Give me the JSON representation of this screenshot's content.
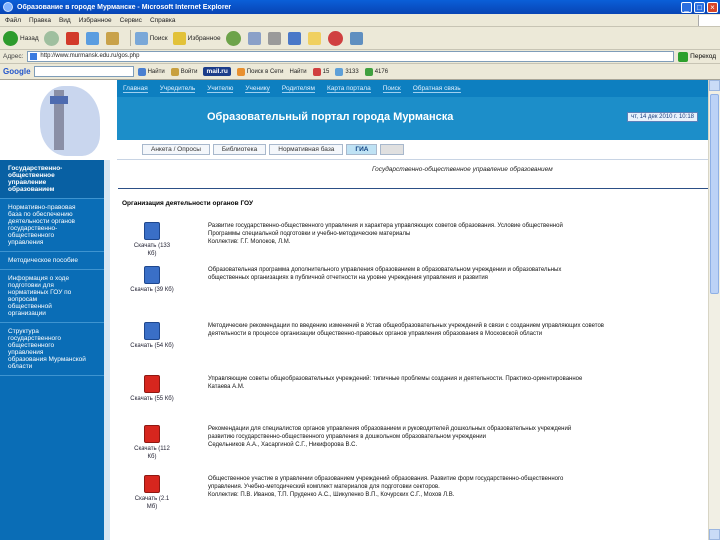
{
  "window": {
    "title": "Образование в городе Мурманске - Microsoft Internet Explorer"
  },
  "menu": [
    "Файл",
    "Правка",
    "Вид",
    "Избранное",
    "Сервис",
    "Справка"
  ],
  "toolbar": {
    "back": "Назад",
    "search": "Поиск",
    "favorites": "Избранное"
  },
  "address": {
    "label": "Адрес:",
    "url": "http://www.murmansk.edu.ru/gos.php",
    "go": "Переход"
  },
  "google_bar": {
    "label": "Google",
    "items": [
      "Найти",
      "Войти"
    ],
    "mailru": "mail.ru",
    "search_placeholder": "Поиск в Сети",
    "right": [
      "Найти",
      "15",
      "3133",
      "4176"
    ]
  },
  "site": {
    "nav": [
      "Главная",
      "Учредитель",
      "Учителю",
      "Ученику",
      "Родителям",
      "Карта портала",
      "Поиск",
      "Обратная связь"
    ],
    "title": "Образовательный портал города Мурманска",
    "date": "чт, 14 дек 2010 г. 10:18",
    "tabs": [
      "Анкета / Опросы",
      "Библиотека",
      "Нормативная база",
      "ГИА"
    ],
    "sidebar": [
      "Государственно-\nобщественное\nуправление\nобразованием",
      "Нормативно-правовая\nбаза по обеспечению\nдеятельности органов\nгосударственно-\nобщественного\nуправления",
      "Методическое пособие",
      "Информация о ходе\nподготовки для\nнормативных ГОУ по\nвопросам\nобщественной\nорганизации",
      "Структура\nгосударственного\nобщественного\nуправления\nобразования Мурманской\nобласти"
    ],
    "subhead": "Государственно-общественное управление образованием",
    "section": "Организация деятельности органов ГОУ",
    "docs": [
      {
        "icon": "word-doc-icon",
        "link": "Скачать\n(133 Кб)",
        "desc": "Развитие государственно-общественного управления и характера управляющих советов образования. Условие общественной\nПрограммы специальной подготовки и учебно-методические материалы\nКоллектив: Г.Г. Молоков, Л.М."
      },
      {
        "icon": "word-doc-icon",
        "link": "Скачать (39\nКб)",
        "desc": "Образовательная программа дополнительного управления образованием в образовательном учреждении и образовательных\nобщественных организациях в публичной отчетности на уровне учреждения управления и развития"
      },
      {
        "icon": "word-doc-icon",
        "link": "Скачать (54\nКб)",
        "desc": "Методические рекомендации по введению изменений в Устав общеобразовательных учреждений в связи с созданием управляющих советов\nдеятельности в процессе организации общественно-правовых органов управления образования в Московской области"
      },
      {
        "icon": "pdf-doc-icon",
        "link": "Скачать (55\nКб)",
        "desc": "Управляющие советы общеобразовательных учреждений: типичные проблемы создания и деятельности. Практико-ориентированное\nКатаева А.М."
      },
      {
        "icon": "pdf-doc-icon",
        "link": "Скачать (112\nКб)",
        "desc": "Рекомендации для специалистов органов управления образованием и руководителей дошкольных образовательных учреждений\nразвитию государственно-общественного управления в дошкольном образовательном учреждении\nСедельников А.А., Хасаргиной С.Г., Никифорова В.С."
      },
      {
        "icon": "pdf-doc-icon",
        "link": "Скачать (2.1\nМб)",
        "desc": "Общественное участие в управлении образованием учреждений образования. Развитие форм государственно-общественного\nуправления. Учебно-методический комплект материалов для подготовки секторов.\nКоллектив: П.В. Иванов, Т.П. Пруденко А.С., Шикуленко В.П., Кочурских С.Г., Мохов Л.В."
      }
    ]
  }
}
